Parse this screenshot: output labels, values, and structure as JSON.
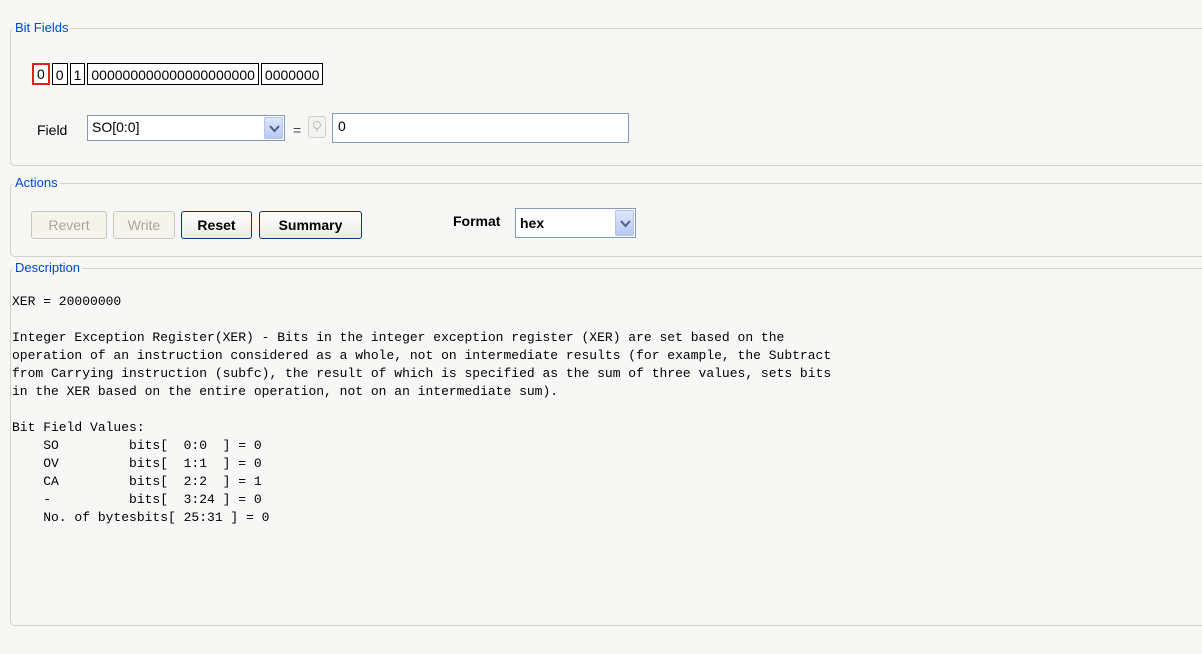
{
  "bit_fields": {
    "legend": "Bit Fields",
    "bits": [
      "0",
      "0",
      "1",
      "000000000000000000000",
      "0000000"
    ],
    "field_label": "Field",
    "field_value": "SO[0:0]",
    "equals": "=",
    "value": "0"
  },
  "actions": {
    "legend": "Actions",
    "revert": "Revert",
    "write": "Write",
    "reset": "Reset",
    "summary": "Summary",
    "format_label": "Format",
    "format_value": "hex"
  },
  "description": {
    "legend": "Description",
    "text": "XER = 20000000\n\nInteger Exception Register(XER) - Bits in the integer exception register (XER) are set based on the\noperation of an instruction considered as a whole, not on intermediate results (for example, the Subtract\nfrom Carrying instruction (subfc), the result of which is specified as the sum of three values, sets bits\nin the XER based on the entire operation, not on an intermediate sum).\n\nBit Field Values:\n    SO         bits[  0:0  ] = 0\n    OV         bits[  1:1  ] = 0\n    CA         bits[  2:2  ] = 1\n    -          bits[  3:24 ] = 0\n    No. of bytesbits[ 25:31 ] = 0"
  }
}
